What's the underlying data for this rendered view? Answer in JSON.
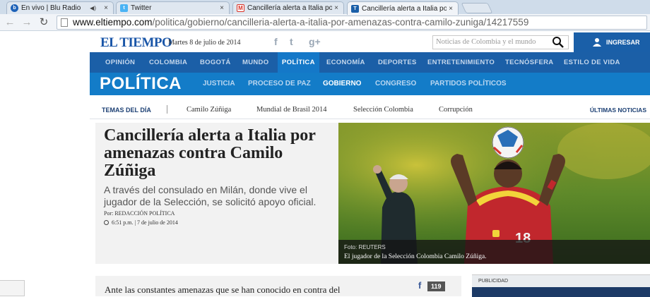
{
  "browser": {
    "tabs": [
      {
        "label": "En vivo | Blu Radio",
        "close": "×",
        "active": false,
        "favicon_color": "#1e62b8"
      },
      {
        "label": "Twitter",
        "close": "×",
        "active": false,
        "favicon_color": "#4ab3f4"
      },
      {
        "label": "Cancillería alerta a Italia po",
        "close": "×",
        "active": false,
        "favicon_color": "#d93025"
      },
      {
        "label": "Cancillería alerta a Italia po",
        "close": "×",
        "active": true,
        "favicon_color": "#1a5fa8"
      }
    ],
    "url_host": "www.eltiempo.com",
    "url_path": "/politica/gobierno/cancilleria-alerta-a-italia-por-amenazas-contra-camilo-zuniga/14217559"
  },
  "site": {
    "logo": "EL TIEMPO",
    "date": "Martes 8 de julio de 2014",
    "social": [
      "f",
      "t",
      "g+"
    ],
    "search_placeholder": "Noticias de Colombia y el mundo",
    "login": "INGRESAR",
    "brand_color": "#1a5fa8"
  },
  "main_nav": [
    "OPINIÓN",
    "COLOMBIA",
    "BOGOTÁ",
    "MUNDO",
    "POLÍTICA",
    "ECONOMÍA",
    "DEPORTES",
    "ENTRETENIMIENTO",
    "TECNÓSFERA",
    "ESTILO DE VIDA"
  ],
  "main_nav_active": "POLÍTICA",
  "section": {
    "title": "POLÍTICA",
    "subnav": [
      "JUSTICIA",
      "PROCESO DE PAZ",
      "GOBIERNO",
      "CONGRESO",
      "PARTIDOS POLÍTICOS"
    ],
    "active": "GOBIERNO"
  },
  "topics": {
    "label": "TEMAS DEL DÍA",
    "items": [
      "Camilo Zúñiga",
      "Mundial de Brasil 2014",
      "Selección Colombia",
      "Corrupción"
    ],
    "latest": "ÚLTIMAS NOTICIAS"
  },
  "article": {
    "headline": "Cancillería alerta a Italia por amenazas contra Camilo Zúñiga",
    "deck": "A través del consulado en Milán, donde vive el jugador de la Selección, se solicitó apoyo oficial.",
    "byline": "Por: REDACCIÓN POLÍTICA",
    "dateline": "6:51 p.m. | 7 de julio de 2014",
    "photo_credit": "Foto: REUTERS",
    "photo_caption": "El jugador de la Selección Colombia Camilo Zúñiga.",
    "jersey_number": "18",
    "body_start": "Ante las constantes amenazas que se han conocido en contra del",
    "fb_count": "119"
  },
  "ads": {
    "label": "PUBLICIDAD"
  }
}
